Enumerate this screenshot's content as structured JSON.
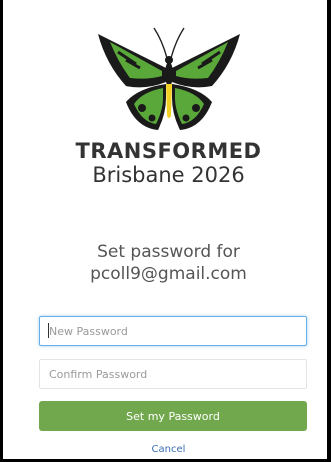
{
  "brand": {
    "title": "TRANSFORMED",
    "subtitle": "Brisbane 2026"
  },
  "heading": {
    "line1": "Set password for",
    "line2": "pcoll9@gmail.com"
  },
  "form": {
    "new_password_placeholder": "New Password",
    "confirm_password_placeholder": "Confirm Password",
    "submit_label": "Set my Password",
    "cancel_label": "Cancel"
  },
  "colors": {
    "accent": "#72a84d",
    "focus": "#66afe9",
    "link": "#3b6fb0"
  }
}
